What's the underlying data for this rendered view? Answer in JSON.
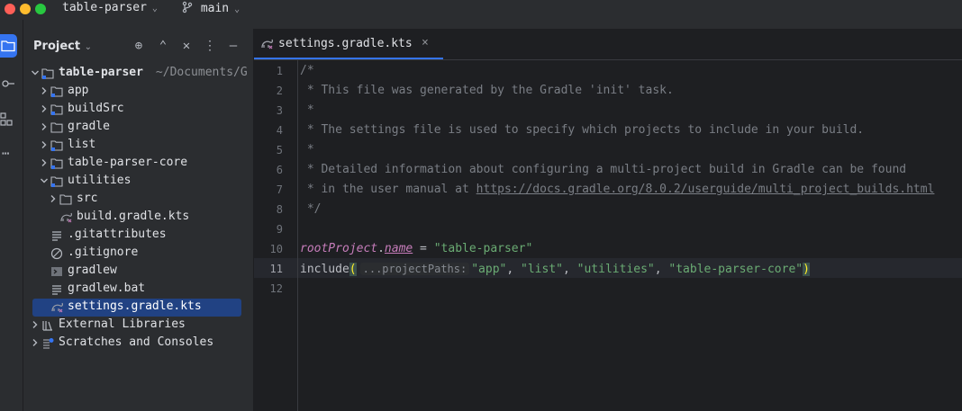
{
  "titlebar": {
    "project_name": "table-parser",
    "branch": "main"
  },
  "colors": {
    "accent": "#3574f0",
    "selection": "#214283",
    "string": "#6aab73",
    "keyword": "#c77dbb",
    "comment": "#7a7e85"
  },
  "project_panel": {
    "title": "Project",
    "tree": [
      {
        "label": "table-parser",
        "path": "~/Documents/G",
        "depth": 0,
        "expanded": true,
        "icon": "module-folder-icon"
      },
      {
        "label": "app",
        "depth": 1,
        "expanded": false,
        "icon": "module-folder-icon"
      },
      {
        "label": "buildSrc",
        "depth": 1,
        "expanded": false,
        "icon": "module-folder-icon"
      },
      {
        "label": "gradle",
        "depth": 1,
        "expanded": false,
        "icon": "folder-icon"
      },
      {
        "label": "list",
        "depth": 1,
        "expanded": false,
        "icon": "module-folder-icon"
      },
      {
        "label": "table-parser-core",
        "depth": 1,
        "expanded": false,
        "icon": "module-folder-icon"
      },
      {
        "label": "utilities",
        "depth": 1,
        "expanded": true,
        "icon": "module-folder-icon"
      },
      {
        "label": "src",
        "depth": 2,
        "expanded": false,
        "icon": "folder-icon"
      },
      {
        "label": "build.gradle.kts",
        "depth": 2,
        "icon": "gradle-kts-icon"
      },
      {
        "label": ".gitattributes",
        "depth": 1,
        "icon": "text-file-icon"
      },
      {
        "label": ".gitignore",
        "depth": 1,
        "icon": "ignore-file-icon"
      },
      {
        "label": "gradlew",
        "depth": 1,
        "icon": "shell-file-icon"
      },
      {
        "label": "gradlew.bat",
        "depth": 1,
        "icon": "text-file-icon"
      },
      {
        "label": "settings.gradle.kts",
        "depth": 1,
        "icon": "gradle-kts-icon",
        "selected": true
      },
      {
        "label": "External Libraries",
        "depth": 0,
        "expanded": false,
        "icon": "library-icon"
      },
      {
        "label": "Scratches and Consoles",
        "depth": 0,
        "expanded": false,
        "icon": "scratches-icon"
      }
    ]
  },
  "editor": {
    "tab_label": "settings.gradle.kts",
    "current_line": 11,
    "lines": [
      {
        "n": "1",
        "text": "/*"
      },
      {
        "n": "2",
        "text": " * This file was generated by the Gradle 'init' task."
      },
      {
        "n": "3",
        "text": " *"
      },
      {
        "n": "4",
        "text": " * The settings file is used to specify which projects to include in your build."
      },
      {
        "n": "5",
        "text": " *"
      },
      {
        "n": "6",
        "text": " * Detailed information about configuring a multi-project build in Gradle can be found"
      },
      {
        "n": "7",
        "text_prefix": " * in the user manual at ",
        "url": "https://docs.gradle.org/8.0.2/userguide/multi_project_builds.html"
      },
      {
        "n": "8",
        "text": " */"
      },
      {
        "n": "9",
        "text": ""
      },
      {
        "n": "10",
        "root": "rootProject",
        "dot": ".",
        "prop": "name",
        "eq": " = ",
        "value": "\"table-parser\""
      },
      {
        "n": "11",
        "fn": "include",
        "open": "(",
        "hint": "...projectPaths:",
        "args": [
          "\"app\"",
          "\"list\"",
          "\"utilities\"",
          "\"table-parser-core\""
        ],
        "sep": ", ",
        "close": ")"
      },
      {
        "n": "12",
        "text": ""
      }
    ]
  }
}
